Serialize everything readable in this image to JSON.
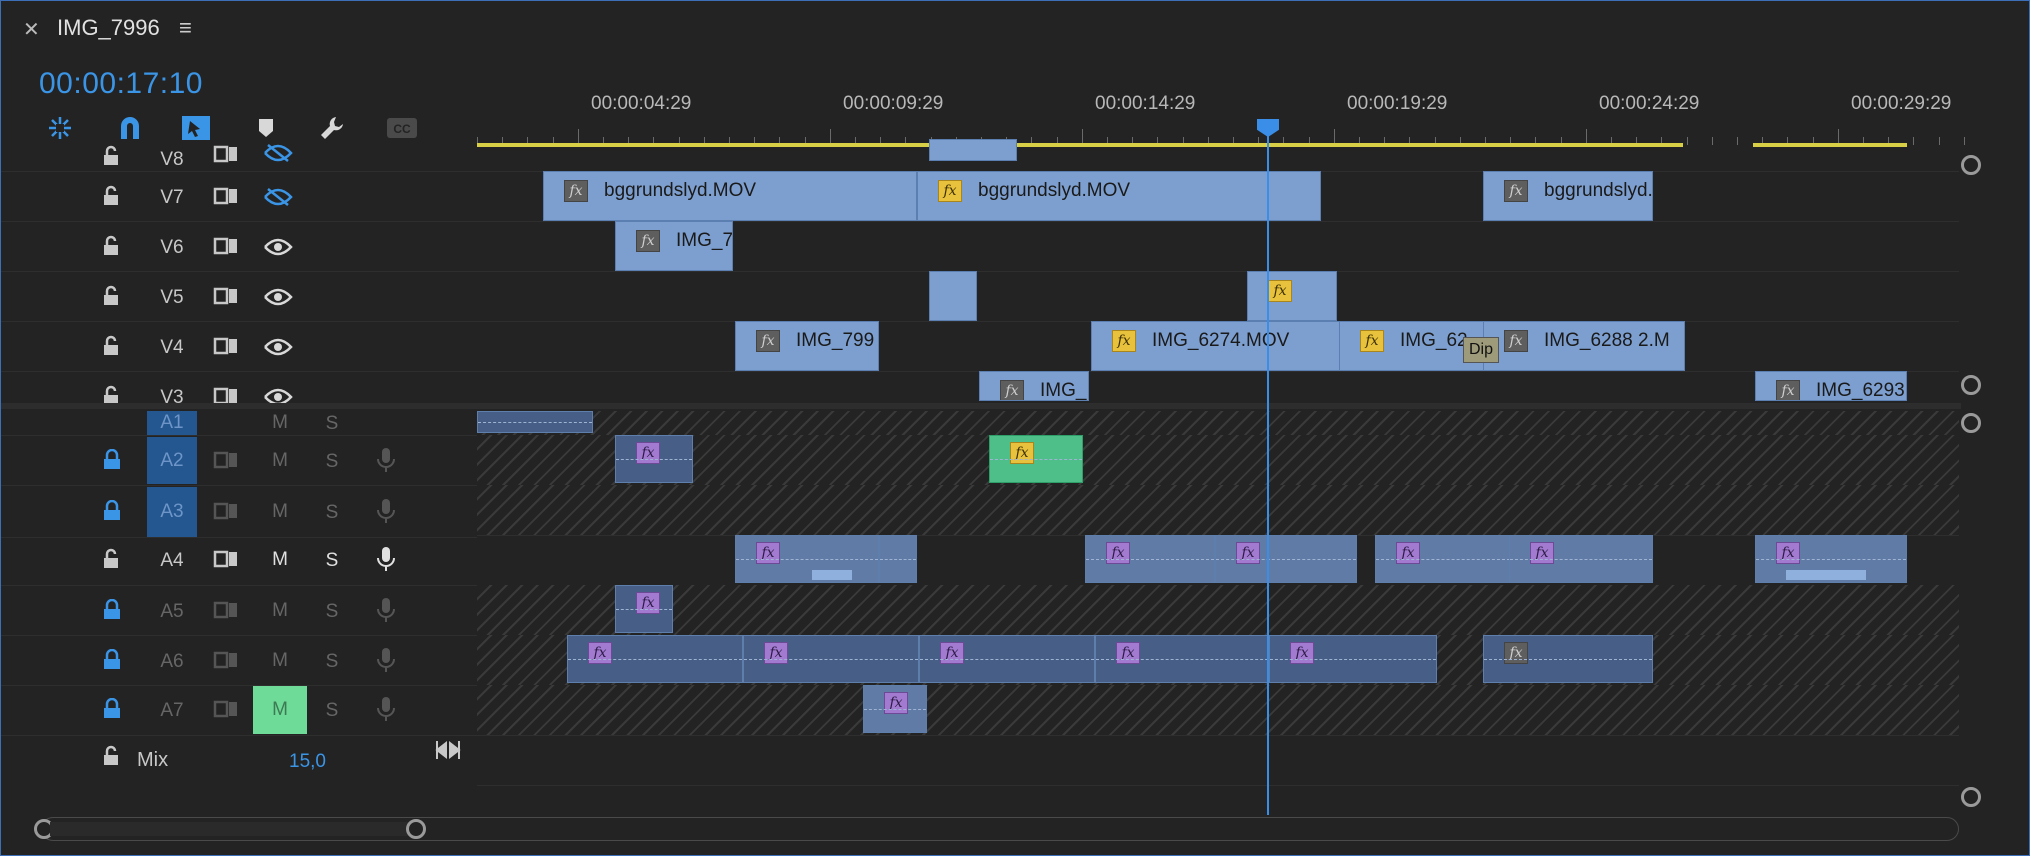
{
  "panel": {
    "title": "IMG_7996",
    "timecode": "00:00:17:10"
  },
  "ruler": {
    "labels": [
      "00:00:04:29",
      "00:00:09:29",
      "00:00:14:29",
      "00:00:19:29",
      "00:00:24:29",
      "00:00:29:29"
    ]
  },
  "video_tracks": [
    {
      "name": "V8"
    },
    {
      "name": "V7"
    },
    {
      "name": "V6"
    },
    {
      "name": "V5"
    },
    {
      "name": "V4"
    },
    {
      "name": "V3"
    }
  ],
  "audio_tracks": [
    {
      "name": "A1",
      "m": "M",
      "s": "S"
    },
    {
      "name": "A2",
      "m": "M",
      "s": "S"
    },
    {
      "name": "A3",
      "m": "M",
      "s": "S"
    },
    {
      "name": "A4",
      "m": "M",
      "s": "S"
    },
    {
      "name": "A5",
      "m": "M",
      "s": "S"
    },
    {
      "name": "A6",
      "m": "M",
      "s": "S"
    },
    {
      "name": "A7",
      "m": "M",
      "s": "S"
    }
  ],
  "clips": {
    "v7_1": "bggrundslyd.MOV",
    "v7_2": "bggrundslyd.MOV",
    "v7_3": "bggrundslyd.",
    "v6_1": "IMG_7",
    "v4_1": "IMG_799",
    "v4_2": "IMG_6274.MOV",
    "v4_3": "IMG_62",
    "v4_4": "IMG_6288 2.M",
    "v3_1": "IMG_",
    "v3_2": "IMG_6293",
    "transition": "Dip"
  },
  "fx_label": "fx",
  "mix": {
    "label": "Mix",
    "value": "15,0"
  },
  "colors": {
    "accent": "#3b95e6",
    "video_clip": "#7d9fcf",
    "audio_clip": "#475f86",
    "work_area": "#d8cf46",
    "mute_active": "#6fdb98",
    "target_track": "#24568f"
  },
  "icons": {
    "toolbar": [
      "ripple-icon",
      "snap-magnet-icon",
      "linked-selection-icon",
      "marker-icon",
      "wrench-icon",
      "captions-icon"
    ]
  }
}
